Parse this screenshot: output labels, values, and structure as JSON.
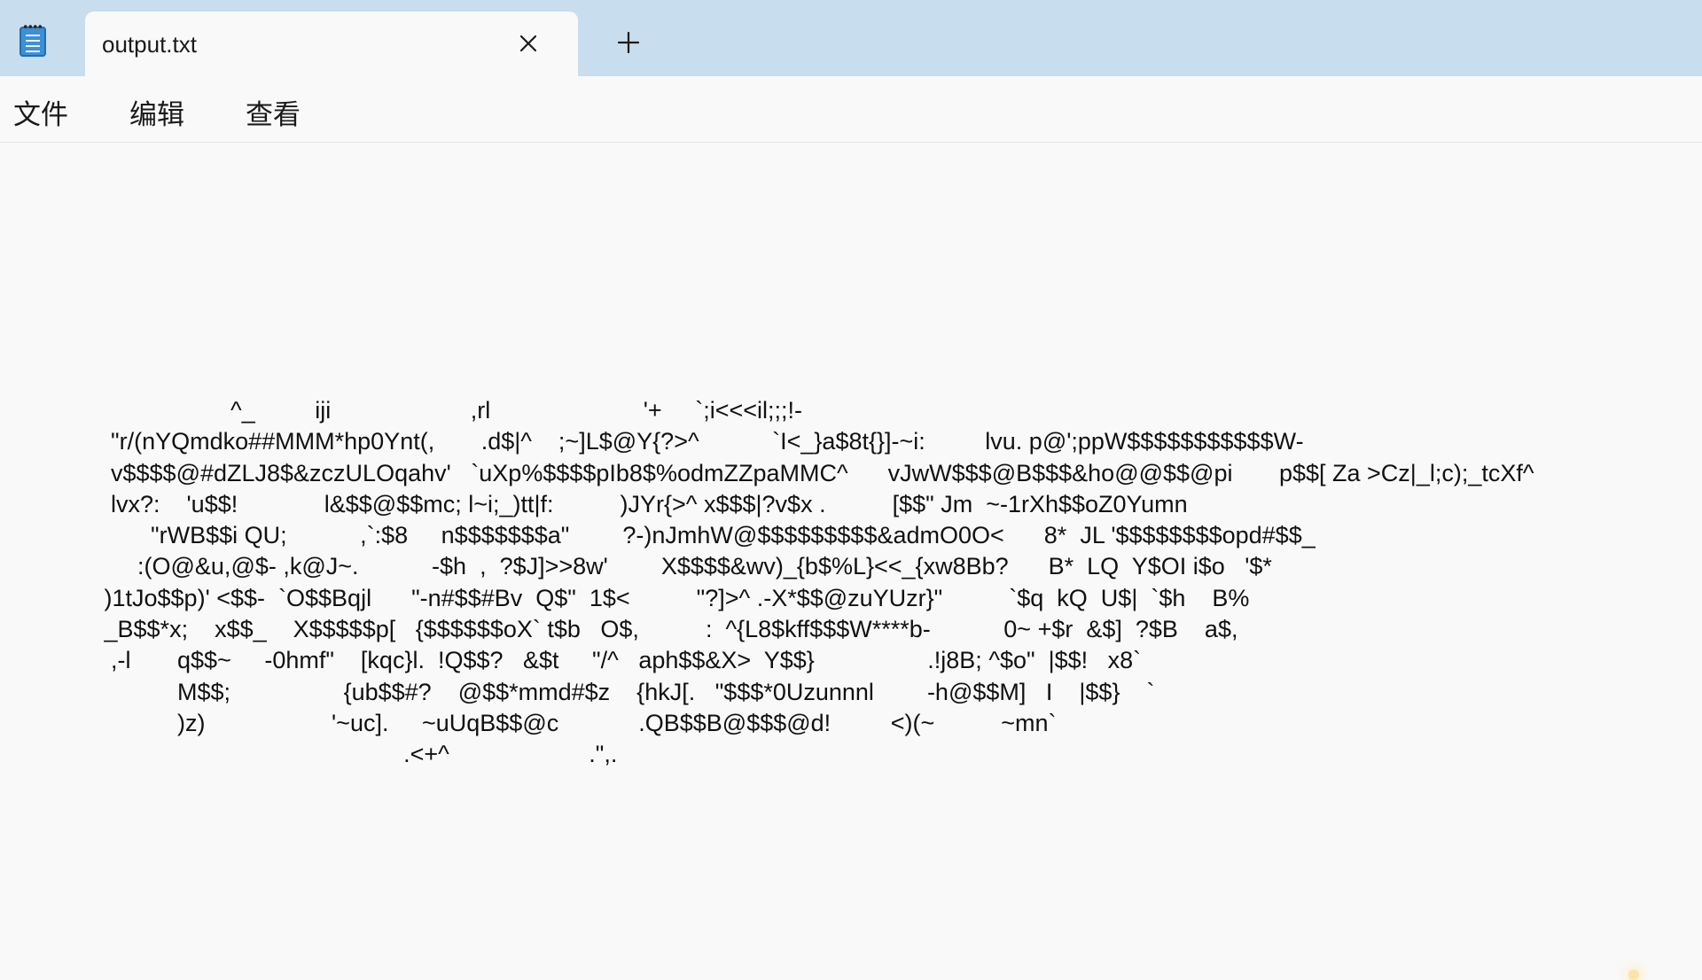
{
  "app": {
    "icon": "notepad-icon"
  },
  "tab": {
    "title": "output.txt",
    "close_icon": "close-icon",
    "new_tab_icon": "plus-icon"
  },
  "menu": {
    "file": "文件",
    "edit": "编辑",
    "view": "查看"
  },
  "editor": {
    "lines": [
      "                    ^_         iji                     ,rl                       '+     `;i<<<il;;;!-",
      "  \"r/(nYQmdko##MMM*hp0Ynt(,       .d$|^    ;~]L$@Y{?>^           `I<_}a$8t{}]-~i:         lvu. p@';ppW$$$$$$$$$$$W-",
      "  v$$$$@#dZLJ8$&zczULOqahv'   `uXp%$$$$pIb8$%odmZZpaMMC^      vJwW$$$@B$$$&ho@@$$@pi       p$$[ Za >Cz|_l;c);_tcXf^",
      "  lvx?:    'u$$!             l&$$@$$mc; l~i;_)tt|f:          )JYr{>^ x$$$|?v$x .          [$$\" Jm  ~-1rXh$$oZ0Yumn",
      "        \"rWB$$i QU;           ,`:$8     n$$$$$$$a\"        ?-)nJmhW@$$$$$$$$$&admO0O<      8*  JL '$$$$$$$$opd#$$_",
      "      :(O@&u,@$- ,k@J~.           -$h  ,  ?$J]>>8w'        X$$$$&wv)_{b$%L}<<_{xw8Bb?      B*  LQ  Y$OI i$o   '$*",
      " )1tJo$$p)' <$$-  `O$$Bqjl      \"-n#$$#Bv  Q$\"  1$<          \"?]>^ .-X*$$@zuYUzr}\"          `$q  kQ  U$|  `$h    B%",
      " _B$$*x;    x$$_    X$$$$$p[   {$$$$$$oX` t$b   O$,          :  ^{L8$kff$$$W****b-           0~ +$r  &$]  ?$B    a$,",
      "  ,-l       q$$~     -0hmf\"    [kqc}l.  !Q$$?   &$t     \"/^   aph$$&X>  Y$$}                 .!j8B; ^$o\"  |$$!   x8`",
      "            M$$;                 {ub$$#?    @$$*mmd#$z    {hkJ[.   \"$$$*0Uzunnnl        -h@$$M]   I    |$$}    `",
      "            )z)                   '~uc].     ~uUqB$$@c            .QB$$B@$$$@d!         <)(~          ~mn`",
      "                                              .<+^                     .\",."
    ]
  },
  "colors": {
    "tabbar_bg": "#c8dded",
    "window_bg": "#f9f9f9",
    "text": "#1a1a1a"
  }
}
